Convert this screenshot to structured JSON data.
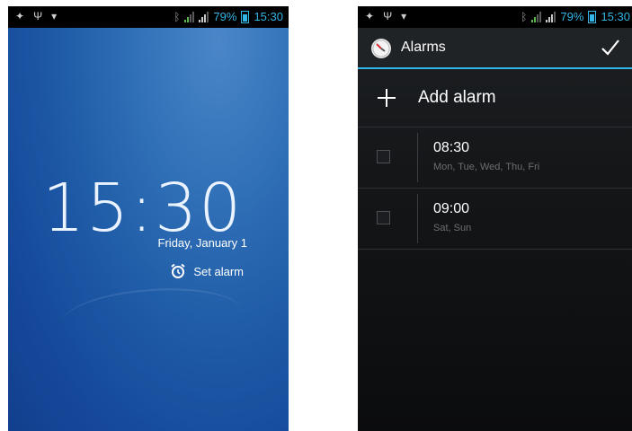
{
  "status_bar": {
    "battery_percent": "79%",
    "time": "15:30",
    "icons": [
      "usb-debug-icon",
      "usb-icon",
      "wifi-icon",
      "bluetooth-icon",
      "signal-icon",
      "signal-icon",
      "battery-icon"
    ]
  },
  "lock_screen": {
    "time": "15:30",
    "date": "Friday, January 1",
    "set_alarm_label": "Set alarm"
  },
  "alarms_screen": {
    "title": "Alarms",
    "add_alarm_label": "Add alarm",
    "alarms": [
      {
        "time": "08:30",
        "days": "Mon, Tue, Wed, Thu, Fri",
        "enabled": false
      },
      {
        "time": "09:00",
        "days": "Sat, Sun",
        "enabled": false
      }
    ],
    "accent_color": "#33b5e5"
  }
}
